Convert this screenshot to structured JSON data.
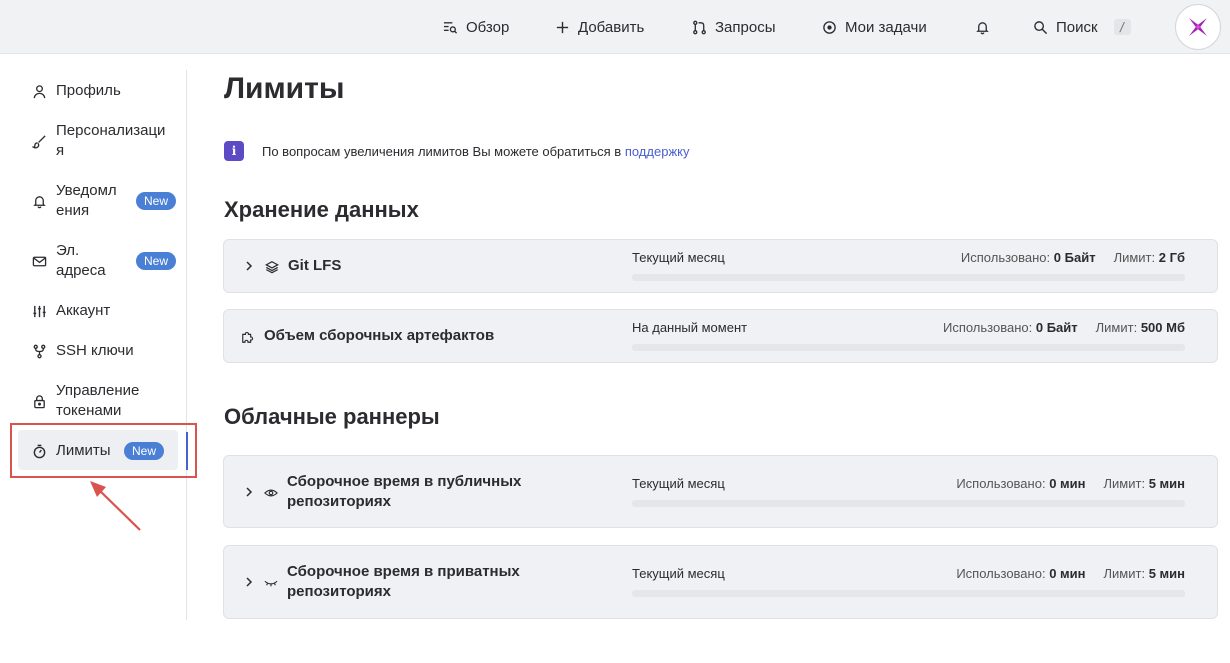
{
  "topbar": {
    "overview": "Обзор",
    "add": "Добавить",
    "requests": "Запросы",
    "tasks": "Мои задачи",
    "search": "Поиск",
    "search_shortcut": "/"
  },
  "sidebar": {
    "items": [
      {
        "label": "Профиль",
        "icon": "user-icon"
      },
      {
        "label": "Персонализаци\nя",
        "icon": "brush-icon"
      },
      {
        "label": "Уведомл\nения",
        "icon": "bell-icon",
        "badge": "New"
      },
      {
        "label": "Эл.\nадреса",
        "icon": "mail-icon",
        "badge": "New"
      },
      {
        "label": "Аккаунт",
        "icon": "sliders-icon"
      },
      {
        "label": "SSH ключи",
        "icon": "key-icon"
      },
      {
        "label": "Управление\nтокенами",
        "icon": "lock-icon"
      },
      {
        "label": "Лимиты",
        "icon": "stopwatch-icon",
        "badge": "New",
        "active": true
      }
    ]
  },
  "main": {
    "title": "Лимиты",
    "info_text": "По вопросам увеличения лимитов Вы можете обратиться в ",
    "info_link": "поддержку",
    "storage": {
      "title": "Хранение данных",
      "cards": [
        {
          "name": "Git LFS",
          "period": "Текущий месяц",
          "used_label": "Использовано:",
          "used": "0 Байт",
          "limit_label": "Лимит:",
          "limit": "2 Гб",
          "progress": 0
        },
        {
          "name": "Объем сборочных артефактов",
          "period": "На данный момент",
          "used_label": "Использовано:",
          "used": "0 Байт",
          "limit_label": "Лимит:",
          "limit": "500 Мб",
          "progress": 0
        }
      ]
    },
    "runners": {
      "title": "Облачные раннеры",
      "cards": [
        {
          "name": "Сборочное время в публичных\nрепозиториях",
          "period": "Текущий месяц",
          "used_label": "Использовано:",
          "used": "0 мин",
          "limit_label": "Лимит:",
          "limit": "5 мин",
          "progress": 0
        },
        {
          "name": "Сборочное время в приватных\nрепозиториях",
          "period": "Текущий месяц",
          "used_label": "Использовано:",
          "used": "0 мин",
          "limit_label": "Лимит:",
          "limit": "5 мин",
          "progress": 0
        }
      ]
    }
  },
  "colors": {
    "accent": "#4a5fd0",
    "badge": "#4a7fd6",
    "info": "#5b4bc4",
    "highlight": "#d9534f"
  }
}
